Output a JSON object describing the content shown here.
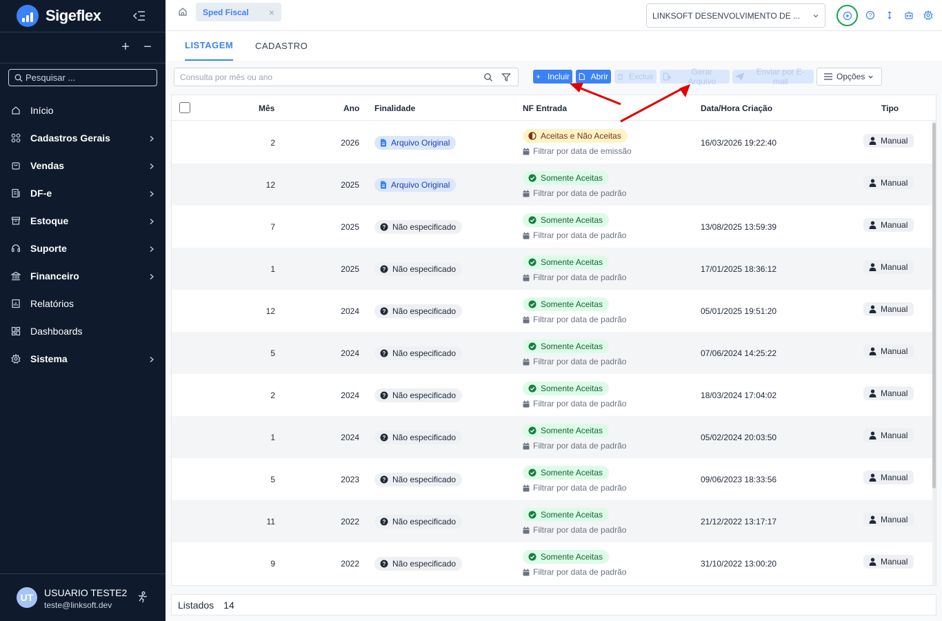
{
  "app": {
    "name": "Sigeflex",
    "search_placeholder": "Pesquisar ..."
  },
  "sidebar": {
    "add_symbol": "+",
    "remove_symbol": "−",
    "items": [
      {
        "label": "Início",
        "icon": "home-icon",
        "has_children": false,
        "bold": false
      },
      {
        "label": "Cadastros Gerais",
        "icon": "grid-icon",
        "has_children": true,
        "bold": true
      },
      {
        "label": "Vendas",
        "icon": "cart-icon",
        "has_children": true,
        "bold": true
      },
      {
        "label": "DF-e",
        "icon": "document-icon",
        "has_children": true,
        "bold": true
      },
      {
        "label": "Estoque",
        "icon": "box-icon",
        "has_children": true,
        "bold": true
      },
      {
        "label": "Suporte",
        "icon": "headset-icon",
        "has_children": true,
        "bold": true
      },
      {
        "label": "Financeiro",
        "icon": "bank-icon",
        "has_children": true,
        "bold": true
      },
      {
        "label": "Relatórios",
        "icon": "report-icon",
        "has_children": false,
        "bold": false
      },
      {
        "label": "Dashboards",
        "icon": "dashboard-icon",
        "has_children": false,
        "bold": false
      },
      {
        "label": "Sistema",
        "icon": "gear-icon",
        "has_children": true,
        "bold": true
      }
    ],
    "user": {
      "initials": "UT",
      "name": "USUARIO TESTE2",
      "email": "teste@linksoft.dev"
    }
  },
  "topbar": {
    "open_tab": "Sped Fiscal",
    "close_symbol": "×",
    "company": "LINKSOFT DESENVOLVIMENTO DE ..."
  },
  "page": {
    "tabs": [
      {
        "label": "LISTAGEM",
        "active": true
      },
      {
        "label": "CADASTRO",
        "active": false
      }
    ],
    "filter_placeholder": "Consulta por mês ou ano",
    "actions": {
      "include": "Incluir",
      "open": "Abrir",
      "delete": "Excluir",
      "generate": "Gerar Arquivo",
      "email": "Enviar por E-mail",
      "options": "Opções"
    },
    "columns": {
      "month": "Mês",
      "year": "Ano",
      "purpose": "Finalidade",
      "nf_entry": "NF Entrada",
      "created": "Data/Hora Criação",
      "type": "Tipo"
    },
    "rows": [
      {
        "month": "2",
        "year": "2026",
        "purpose": "Arquivo Original",
        "purpose_kind": "original",
        "nf": "Aceitas e Não Aceitas",
        "nf_kind": "mixed",
        "filter": "Filtrar por data de emissão",
        "created": "16/03/2026 19:22:40",
        "type": "Manual"
      },
      {
        "month": "12",
        "year": "2025",
        "purpose": "Arquivo Original",
        "purpose_kind": "original",
        "nf": "Somente Aceitas",
        "nf_kind": "accepted",
        "filter": "Filtrar por data de padrão",
        "created": "",
        "type": "Manual"
      },
      {
        "month": "7",
        "year": "2025",
        "purpose": "Não especificado",
        "purpose_kind": "unspecified",
        "nf": "Somente Aceitas",
        "nf_kind": "accepted",
        "filter": "Filtrar por data de padrão",
        "created": "13/08/2025 13:59:39",
        "type": "Manual"
      },
      {
        "month": "1",
        "year": "2025",
        "purpose": "Não especificado",
        "purpose_kind": "unspecified",
        "nf": "Somente Aceitas",
        "nf_kind": "accepted",
        "filter": "Filtrar por data de padrão",
        "created": "17/01/2025 18:36:12",
        "type": "Manual"
      },
      {
        "month": "12",
        "year": "2024",
        "purpose": "Não especificado",
        "purpose_kind": "unspecified",
        "nf": "Somente Aceitas",
        "nf_kind": "accepted",
        "filter": "Filtrar por data de padrão",
        "created": "05/01/2025 19:51:20",
        "type": "Manual"
      },
      {
        "month": "5",
        "year": "2024",
        "purpose": "Não especificado",
        "purpose_kind": "unspecified",
        "nf": "Somente Aceitas",
        "nf_kind": "accepted",
        "filter": "Filtrar por data de padrão",
        "created": "07/06/2024 14:25:22",
        "type": "Manual"
      },
      {
        "month": "2",
        "year": "2024",
        "purpose": "Não especificado",
        "purpose_kind": "unspecified",
        "nf": "Somente Aceitas",
        "nf_kind": "accepted",
        "filter": "Filtrar por data de padrão",
        "created": "18/03/2024 17:04:02",
        "type": "Manual"
      },
      {
        "month": "1",
        "year": "2024",
        "purpose": "Não especificado",
        "purpose_kind": "unspecified",
        "nf": "Somente Aceitas",
        "nf_kind": "accepted",
        "filter": "Filtrar por data de padrão",
        "created": "05/02/2024 20:03:50",
        "type": "Manual"
      },
      {
        "month": "5",
        "year": "2023",
        "purpose": "Não especificado",
        "purpose_kind": "unspecified",
        "nf": "Somente Aceitas",
        "nf_kind": "accepted",
        "filter": "Filtrar por data de padrão",
        "created": "09/06/2023 18:33:56",
        "type": "Manual"
      },
      {
        "month": "11",
        "year": "2022",
        "purpose": "Não especificado",
        "purpose_kind": "unspecified",
        "nf": "Somente Aceitas",
        "nf_kind": "accepted",
        "filter": "Filtrar por data de padrão",
        "created": "21/12/2022 13:17:17",
        "type": "Manual"
      },
      {
        "month": "9",
        "year": "2022",
        "purpose": "Não especificado",
        "purpose_kind": "unspecified",
        "nf": "Somente Aceitas",
        "nf_kind": "accepted",
        "filter": "Filtrar por data de padrão",
        "created": "31/10/2022 13:00:20",
        "type": "Manual"
      }
    ],
    "footer": {
      "label": "Listados",
      "count": "14"
    }
  },
  "colors": {
    "sidebar_bg": "#0f1b2d",
    "accent": "#3b82f6",
    "success": "#16a34a",
    "annotation": "#e00000"
  }
}
